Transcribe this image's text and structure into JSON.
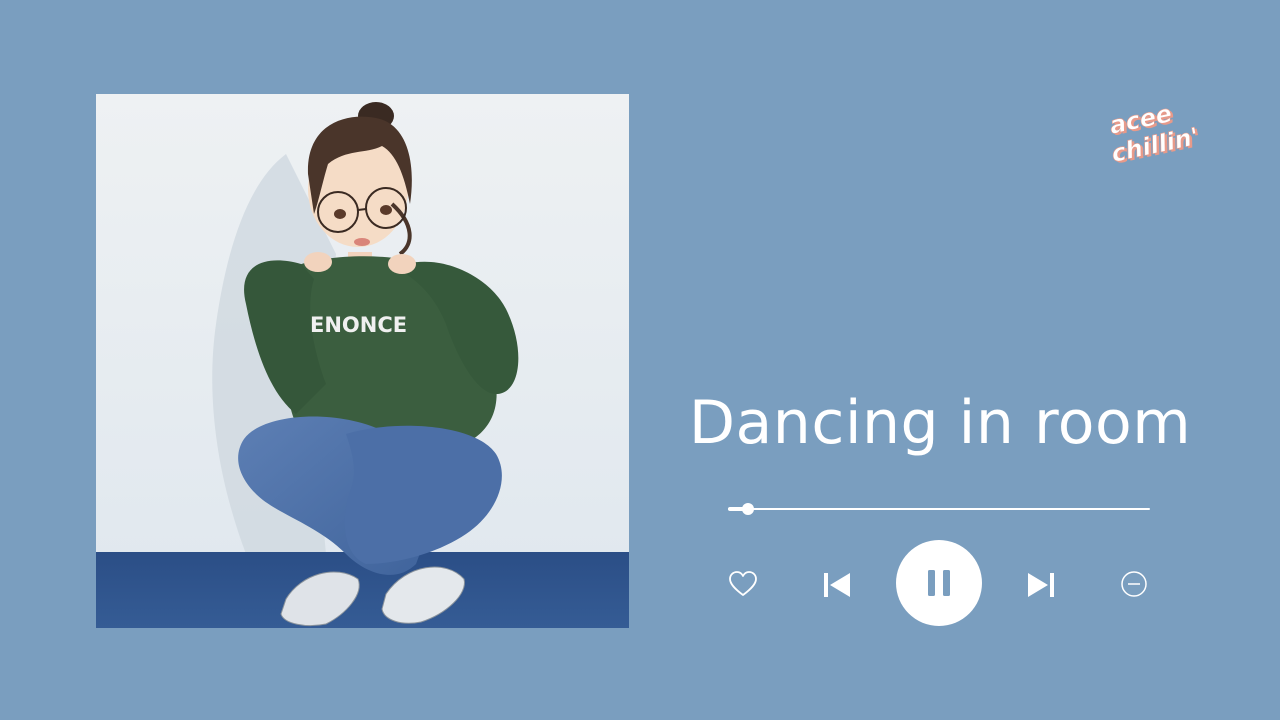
{
  "player": {
    "title": "Dancing in room",
    "progress": 0.047,
    "sweater_text": "ENONCE"
  },
  "logo": {
    "line1": "acee",
    "line2": "chillin'"
  },
  "controls": {
    "like": "heart-outline-icon",
    "previous": "skip-previous-icon",
    "play_pause": "pause-icon",
    "next": "skip-next-icon",
    "remove": "minus-circle-icon"
  },
  "colors": {
    "background": "#7a9ebf",
    "foreground": "#ffffff",
    "pause_icon": "#7a9ebf",
    "logo_fill": "#ffffff",
    "logo_shadow": "#e89a8a"
  }
}
